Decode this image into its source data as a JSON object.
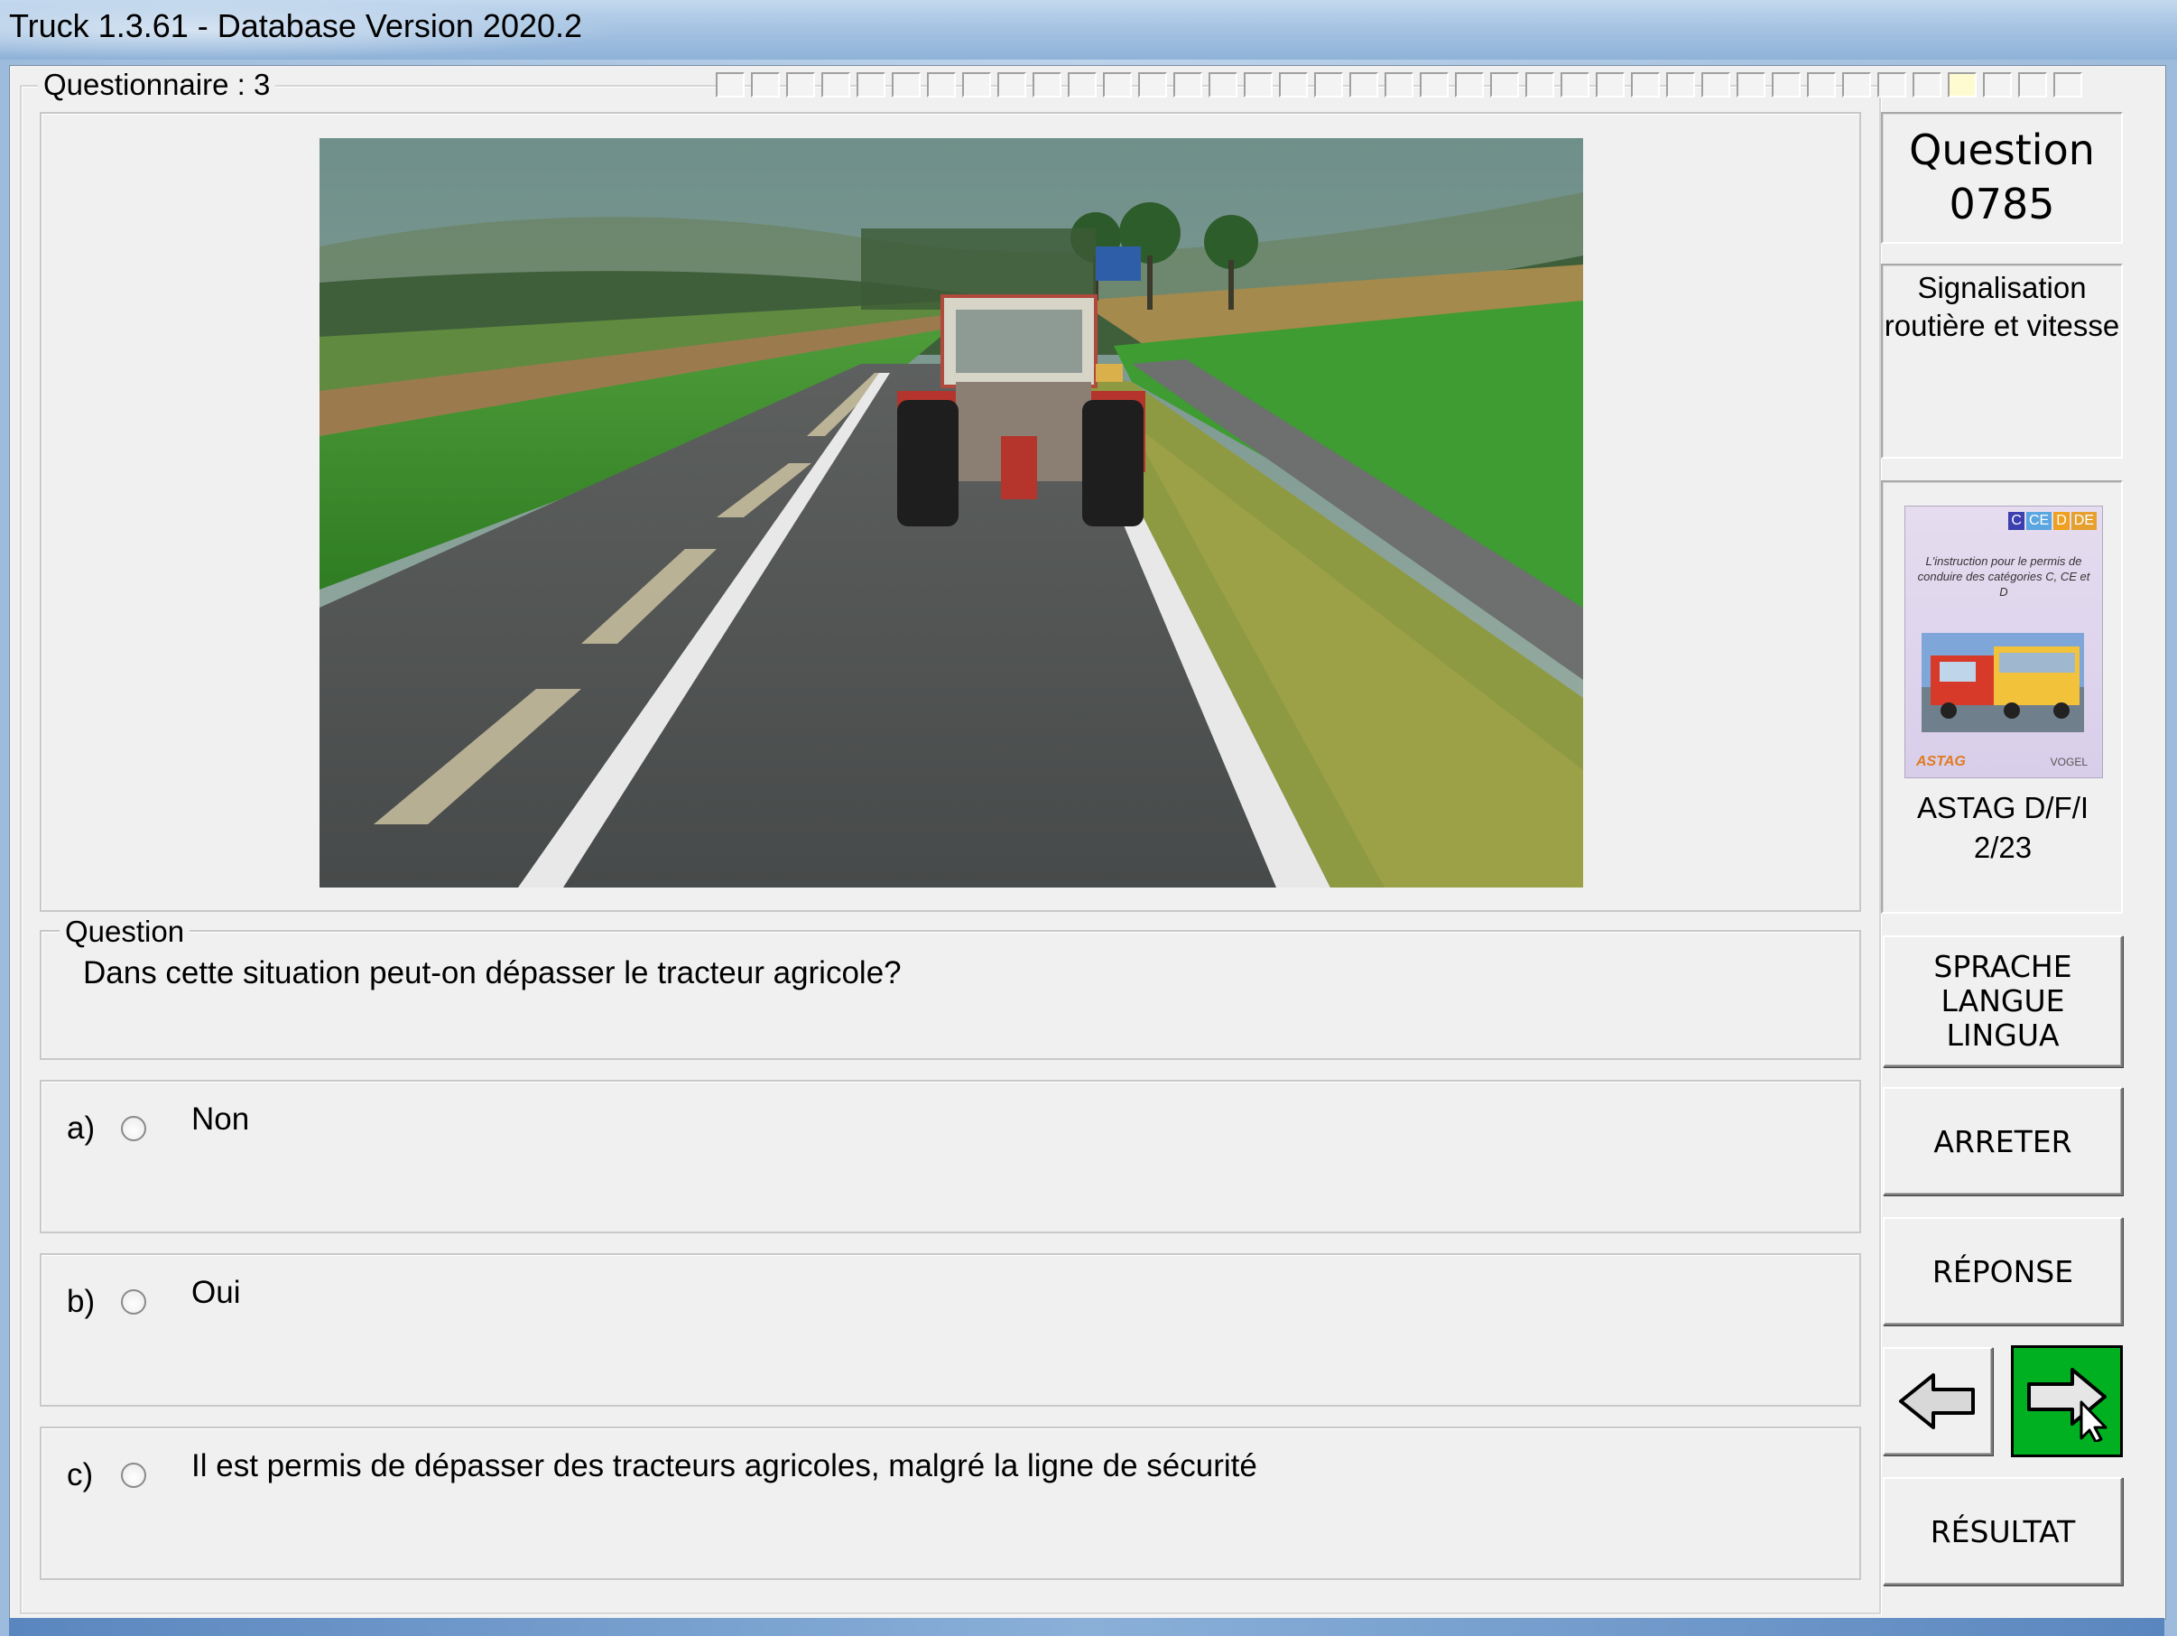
{
  "window": {
    "title": "Truck 1.3.61 - Database Version 2020.2"
  },
  "questionnaire": {
    "label": "Questionnaire : 3",
    "progress_cells": 39,
    "current_index": 35
  },
  "side": {
    "question_label": "Question",
    "question_number": "0785",
    "category_line1": "Signalisation",
    "category_line2": "routière et vitesse",
    "book": {
      "badges": [
        "C",
        "CE",
        "D",
        "DE"
      ],
      "text": "L'instruction pour le permis de conduire des catégories C, CE et D",
      "publisher_left": "ASTAG",
      "publisher_right": "VOGEL"
    },
    "source_line1": "ASTAG D/F/I",
    "source_line2": "2/23"
  },
  "question": {
    "group_label": "Question",
    "text": "Dans cette situation peut-on dépasser le tracteur agricole?"
  },
  "answers": [
    {
      "letter": "a)",
      "text": "Non"
    },
    {
      "letter": "b)",
      "text": "Oui"
    },
    {
      "letter": "c)",
      "text": "Il est permis de dépasser des tracteurs agricoles, malgré la ligne de sécurité"
    }
  ],
  "buttons": {
    "language_line1": "SPRACHE",
    "language_line2": "LANGUE",
    "language_line3": "LINGUA",
    "stop": "ARRETER",
    "answer": "RÉPONSE",
    "result": "RÉSULTAT"
  },
  "colors": {
    "next_button": "#00b020",
    "window_bg": "#f0f0f0"
  }
}
